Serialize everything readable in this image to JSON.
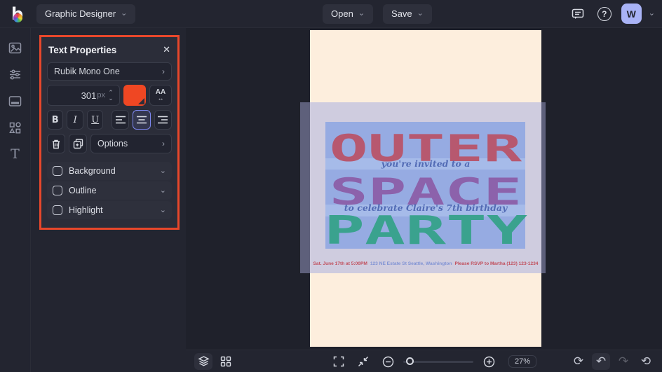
{
  "header": {
    "app_mode": "Graphic Designer",
    "open_label": "Open",
    "save_label": "Save",
    "avatar_initial": "W"
  },
  "sidebar": {
    "items": [
      {
        "name": "image-manager"
      },
      {
        "name": "edit-adjust"
      },
      {
        "name": "templates"
      },
      {
        "name": "graphics-shapes"
      },
      {
        "name": "text-tool"
      }
    ]
  },
  "panel": {
    "title": "Text Properties",
    "font_name": "Rubik Mono One",
    "font_size": "301",
    "font_size_unit": "px",
    "bold_label": "B",
    "italic_label": "I",
    "underline_label": "U",
    "options_label": "Options",
    "toggles": [
      {
        "label": "Background"
      },
      {
        "label": "Outline"
      },
      {
        "label": "Highlight"
      }
    ],
    "accent_border_color": "#e8472b",
    "swatch_color": "#ef4723",
    "close_glyph": "✕"
  },
  "canvas": {
    "poster": {
      "bg_color": "#fdeedd",
      "title_lines": [
        {
          "text": "OUTER",
          "color": "#b7586f"
        },
        {
          "text": "SPACE",
          "color": "#8c62ab"
        },
        {
          "text": "PARTY",
          "color": "#3aa28e"
        }
      ],
      "script_line1": "you're invited to a",
      "script_line2": "to celebrate Claire's 7th birthday",
      "script_color": "#4a63b0",
      "details": [
        {
          "text": "Sat. June 17th at 5:00PM",
          "color": "#c14f5c"
        },
        {
          "text": "123 NE Estate St Seattle, Washington",
          "color": "#8093d4"
        },
        {
          "text": "Please RSVP to Martha (123) 123-1234",
          "color": "#c14f5c"
        }
      ]
    }
  },
  "bottom_toolbar": {
    "zoom_level": "27%"
  }
}
